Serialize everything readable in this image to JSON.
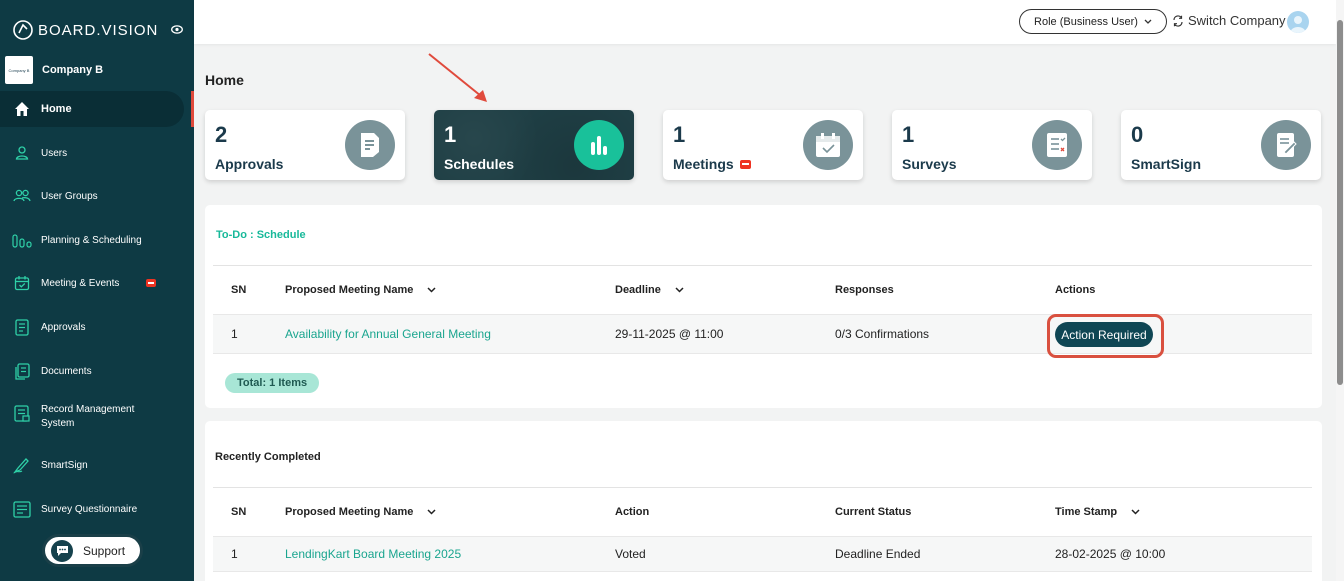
{
  "app": {
    "logo_text": "BOARD.VISION"
  },
  "company": {
    "name": "Company B",
    "logo_text": "Company B"
  },
  "sidebar": {
    "items": [
      {
        "label": "Home",
        "icon": "home-icon",
        "active": true
      },
      {
        "label": "Users",
        "icon": "user-icon"
      },
      {
        "label": "User Groups",
        "icon": "user-group-icon"
      },
      {
        "label": "Planning & Scheduling",
        "icon": "planning-icon"
      },
      {
        "label": "Meeting & Events",
        "icon": "calendar-icon",
        "badge": true
      },
      {
        "label": "Approvals",
        "icon": "approval-icon"
      },
      {
        "label": "Documents",
        "icon": "documents-icon"
      },
      {
        "label": "Record Management System",
        "icon": "record-icon"
      },
      {
        "label": "SmartSign",
        "icon": "smartsign-icon"
      },
      {
        "label": "Survey Questionnaire",
        "icon": "survey-icon"
      }
    ],
    "support_label": "Support"
  },
  "topbar": {
    "role_label": "Role (Business User)",
    "switch_label": "Switch Company"
  },
  "page": {
    "title": "Home"
  },
  "cards": [
    {
      "count": "2",
      "label": "Approvals",
      "icon": "approvals-doc-icon"
    },
    {
      "count": "1",
      "label": "Schedules",
      "icon": "bar-chart-icon",
      "active": true
    },
    {
      "count": "1",
      "label": "Meetings",
      "icon": "calendar-check-icon",
      "badge": true
    },
    {
      "count": "1",
      "label": "Surveys",
      "icon": "survey-list-icon"
    },
    {
      "count": "0",
      "label": "SmartSign",
      "icon": "sign-doc-icon"
    }
  ],
  "todo": {
    "title": "To-Do : Schedule",
    "columns": [
      "SN",
      "Proposed Meeting Name",
      "Deadline",
      "Responses",
      "Actions"
    ],
    "rows": [
      {
        "sn": "1",
        "name": "Availability for Annual General Meeting",
        "deadline": "29-11-2025 @ 11:00",
        "responses": "0/3 Confirmations",
        "action": "Action Required"
      }
    ],
    "total": "Total: 1 Items"
  },
  "completed": {
    "title": "Recently Completed",
    "columns": [
      "SN",
      "Proposed Meeting Name",
      "Action",
      "Current Status",
      "Time Stamp"
    ],
    "rows": [
      {
        "sn": "1",
        "name": "LendingKart Board Meeting 2025",
        "action": "Voted",
        "status": "Deadline Ended",
        "timestamp": "28-02-2025 @ 10:00"
      }
    ]
  },
  "colors": {
    "sidebar_bg": "#0e3a44",
    "accent_green": "#19c19a",
    "link": "#1aa58f",
    "alert_red": "#d9503f"
  }
}
